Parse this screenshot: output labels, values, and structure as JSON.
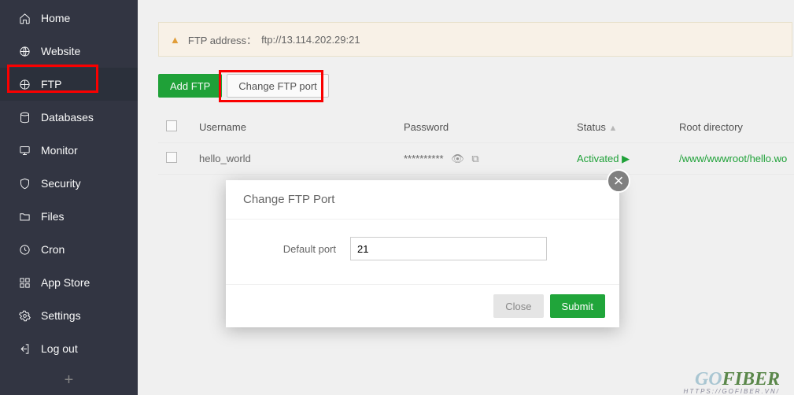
{
  "sidebar": {
    "items": [
      {
        "label": "Home",
        "icon": "home"
      },
      {
        "label": "Website",
        "icon": "globe"
      },
      {
        "label": "FTP",
        "icon": "ftp"
      },
      {
        "label": "Databases",
        "icon": "database"
      },
      {
        "label": "Monitor",
        "icon": "monitor"
      },
      {
        "label": "Security",
        "icon": "shield"
      },
      {
        "label": "Files",
        "icon": "folder"
      },
      {
        "label": "Cron",
        "icon": "clock"
      },
      {
        "label": "App Store",
        "icon": "apps"
      },
      {
        "label": "Settings",
        "icon": "gear"
      },
      {
        "label": "Log out",
        "icon": "logout"
      }
    ]
  },
  "alert": {
    "label": "FTP address：",
    "value": "ftp://13.114.202.29:21"
  },
  "toolbar": {
    "add_label": "Add FTP",
    "change_label": "Change FTP port"
  },
  "table": {
    "headers": {
      "username": "Username",
      "password": "Password",
      "status": "Status",
      "root": "Root directory"
    },
    "rows": [
      {
        "username": "hello_world",
        "password_masked": "**********",
        "status": "Activated",
        "root": "/www/wwwroot/hello.wo"
      }
    ]
  },
  "modal": {
    "title": "Change FTP Port",
    "label": "Default port",
    "value": "21",
    "close": "Close",
    "submit": "Submit"
  },
  "watermark": {
    "a": "GO",
    "b": "FIBER",
    "url": "HTTPS://GOFIBER.VN/"
  }
}
